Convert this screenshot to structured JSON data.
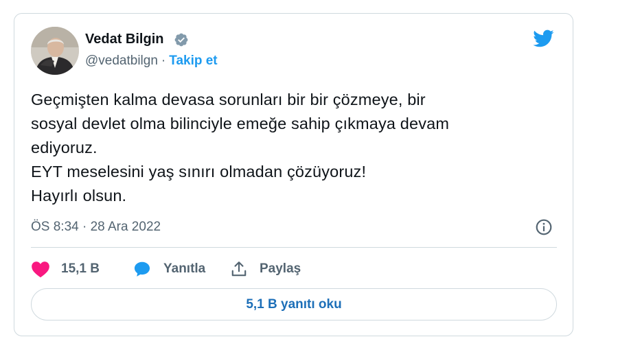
{
  "author": {
    "name": "Vedat Bilgin",
    "handle": "@vedatbilgn",
    "separator": "·",
    "follow_label": "Takip et",
    "verified": true
  },
  "tweet": {
    "lines": [
      "Geçmişten kalma devasa sorunları bir bir çözmeye, bir",
      "sosyal devlet olma bilinciyle emeğe sahip çıkmaya devam",
      "ediyoruz.",
      "EYT meselesini yaş sınırı olmadan çözüyoruz!",
      "Hayırlı olsun."
    ],
    "timestamp": "ÖS 8:34 · 28 Ara 2022"
  },
  "actions": {
    "like_count": "15,1 B",
    "reply_label": "Yanıtla",
    "share_label": "Paylaş"
  },
  "read_replies_label": "5,1 B yanıtı oku",
  "icons": {
    "brand": "twitter-bird-icon",
    "verified": "verified-badge-icon",
    "info": "info-icon",
    "like": "heart-icon",
    "reply": "speech-bubble-icon",
    "share": "share-upload-icon"
  },
  "colors": {
    "brand_blue": "#1d9bf0",
    "like_pink": "#f91880",
    "text_primary": "#0f1419",
    "text_secondary": "#536471",
    "border": "#cfd9de",
    "verified_gray": "#829aab"
  }
}
